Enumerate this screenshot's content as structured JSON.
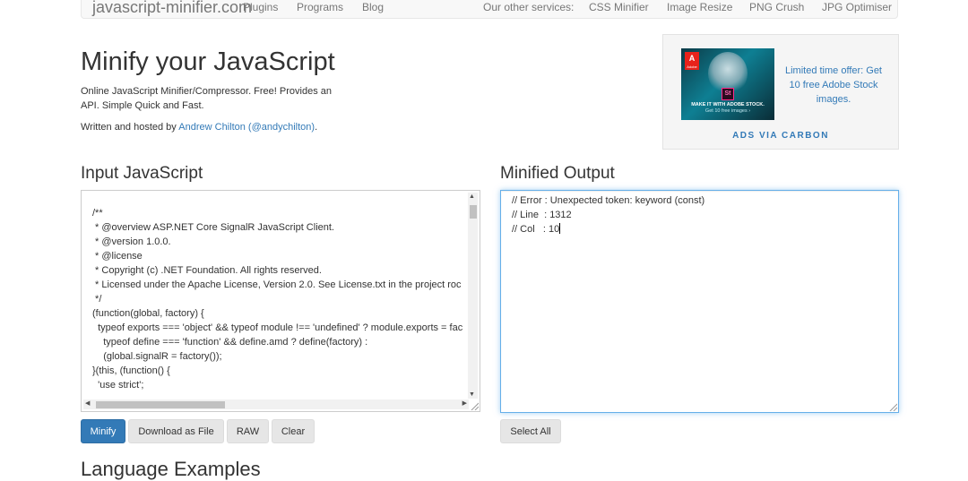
{
  "nav": {
    "brand": "javascript-minifier.com",
    "links": [
      "Plugins",
      "Programs",
      "Blog"
    ],
    "services_label": "Our other services:",
    "services": [
      "CSS Minifier",
      "Image Resize",
      "PNG Crush",
      "JPG Optimiser"
    ]
  },
  "header": {
    "title": "Minify your JavaScript",
    "description": "Online JavaScript Minifier/Compressor. Free! Provides an API. Simple Quick and Fast.",
    "written_by": "Written and hosted by",
    "author_name": "Andrew Chilton",
    "author_handle": "(@andychilton)",
    "author_suffix": "."
  },
  "ad": {
    "logo_text": "A",
    "logo_sub": "Adobe",
    "st_badge": "St",
    "caption": "MAKE IT WITH ADOBE STOCK.",
    "caption_sub": "Get 10 free images ›",
    "text": "Limited time offer: Get 10 free Adobe Stock images.",
    "via": "ADS VIA CARBON"
  },
  "input": {
    "heading": "Input JavaScript",
    "lines": [
      "/**",
      " * @overview ASP.NET Core SignalR JavaScript Client.",
      " * @version 1.0.0.",
      " * @license",
      " * Copyright (c) .NET Foundation. All rights reserved.",
      " * Licensed under the Apache License, Version 2.0. See License.txt in the project roc",
      " */",
      "(function(global, factory) {",
      "  typeof exports === 'object' && typeof module !== 'undefined' ? module.exports = fac",
      "    typeof define === 'function' && define.amd ? define(factory) :",
      "    (global.signalR = factory());",
      "}(this, (function() {",
      "  'use strict';"
    ]
  },
  "output": {
    "heading": "Minified Output",
    "lines": [
      "// Error : Unexpected token: keyword (const)",
      "// Line  : 1312",
      "// Col   : 10"
    ]
  },
  "buttons": {
    "minify": "Minify",
    "download": "Download as File",
    "raw": "RAW",
    "clear": "Clear",
    "select_all": "Select All"
  },
  "language_heading": "Language Examples",
  "colors": {
    "primary": "#337ab7",
    "focus_border": "#66afe9",
    "button_default": "#e6e6e6"
  }
}
